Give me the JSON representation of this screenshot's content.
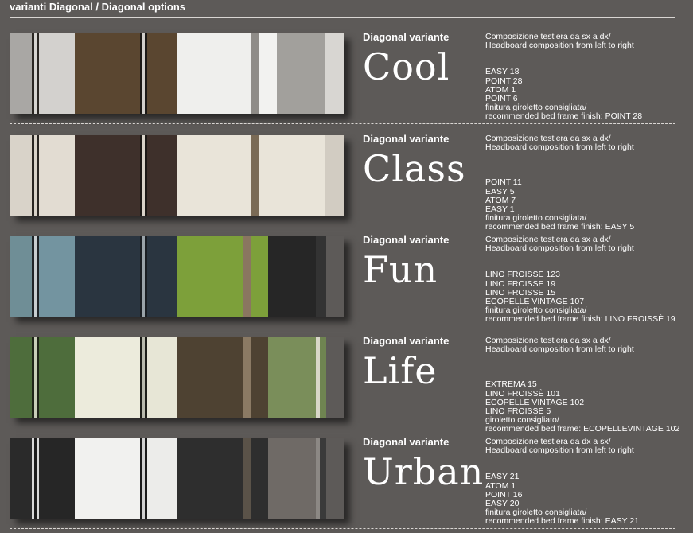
{
  "header": {
    "title": "varianti Diagonal / Diagonal options"
  },
  "rows": [
    {
      "label": "Diagonal variante",
      "name": "Cool",
      "composition_it": "Composizione testiera da sx a dx/",
      "composition_en": "Headboard composition from left to right",
      "items": [
        "EASY 18",
        "POINT 28",
        "ATOM 1",
        "POINT 6"
      ],
      "finish_it": "finitura giroletto consigliata/",
      "finish_en": "recommended bed frame finish: POINT 28",
      "stripes": [
        {
          "color": "#a9a7a4",
          "w": 28
        },
        {
          "color": "#2a2622",
          "w": 3
        },
        {
          "color": "#d6d4d0",
          "w": 3
        },
        {
          "color": "#2a2622",
          "w": 3
        },
        {
          "color": "#d3d1ce",
          "w": 45
        },
        {
          "color": "#5a4630",
          "w": 82
        },
        {
          "color": "#1c1916",
          "w": 3
        },
        {
          "color": "#d2cfcb",
          "w": 3
        },
        {
          "color": "#1c1916",
          "w": 3
        },
        {
          "color": "#5a4630",
          "w": 38
        },
        {
          "color": "#efefed",
          "w": 93
        },
        {
          "color": "#8f8c88",
          "w": 10
        },
        {
          "color": "#f2f2f0",
          "w": 22
        },
        {
          "color": "#a2a09c",
          "w": 60
        },
        {
          "color": "#d8d6d2",
          "w": 24
        }
      ]
    },
    {
      "label": "Diagonal variante",
      "name": "Class",
      "composition_it": "Composizione testiera da sx a dx/",
      "composition_en": "Headboard composition from left to right",
      "items": [
        "POINT 11",
        "EASY 5",
        "ATOM 7",
        "EASY 1"
      ],
      "finish_it": "finitura giroletto consigliata/",
      "finish_en": "recommended bed frame finish: EASY 5",
      "stripes": [
        {
          "color": "#d9d3c9",
          "w": 28
        },
        {
          "color": "#2a2622",
          "w": 3
        },
        {
          "color": "#d9d3c9",
          "w": 3
        },
        {
          "color": "#2a2622",
          "w": 3
        },
        {
          "color": "#e2dcd2",
          "w": 45
        },
        {
          "color": "#3e302b",
          "w": 82
        },
        {
          "color": "#1c1916",
          "w": 3
        },
        {
          "color": "#d9d3c9",
          "w": 3
        },
        {
          "color": "#1c1916",
          "w": 3
        },
        {
          "color": "#3e302b",
          "w": 38
        },
        {
          "color": "#e9e4d9",
          "w": 93
        },
        {
          "color": "#7a6a55",
          "w": 10
        },
        {
          "color": "#e9e4d9",
          "w": 82
        },
        {
          "color": "#d2ccc2",
          "w": 24
        }
      ]
    },
    {
      "label": "Diagonal variante",
      "name": "Fun",
      "composition_it": "Composizione testiera da sx a dx/",
      "composition_en": "Headboard composition from left to right",
      "items": [
        "LINO FROISSE 123",
        "LINO FROISSE 19",
        "LINO FROISSE 15",
        "ECOPELLE VINTAGE 107"
      ],
      "finish_it": "finitura giroletto consigliata/",
      "finish_en": "recommended bed frame finish: LINO FROISSÈ 19",
      "stripes": [
        {
          "color": "#6f8e96",
          "w": 28
        },
        {
          "color": "#1f2428",
          "w": 3
        },
        {
          "color": "#c7cdd0",
          "w": 3
        },
        {
          "color": "#1f2428",
          "w": 3
        },
        {
          "color": "#7394a0",
          "w": 45
        },
        {
          "color": "#2a3540",
          "w": 82
        },
        {
          "color": "#1a1e22",
          "w": 3
        },
        {
          "color": "#9aa3a8",
          "w": 3
        },
        {
          "color": "#1a1e22",
          "w": 3
        },
        {
          "color": "#2a3540",
          "w": 38
        },
        {
          "color": "#7da03a",
          "w": 82
        },
        {
          "color": "#8a7660",
          "w": 10
        },
        {
          "color": "#7da03a",
          "w": 22
        },
        {
          "color": "#262626",
          "w": 60
        },
        {
          "color": "#333333",
          "w": 13
        }
      ]
    },
    {
      "label": "Diagonal variante",
      "name": "Life",
      "composition_it": "Composizione testiera da sx a dx/",
      "composition_en": "Headboard composition from left to right",
      "items": [
        "EXTREMA 15",
        "LINO FROISSÈ 101",
        "ECOPELLE VINTAGE 102",
        "LINO FROISSÈ 5"
      ],
      "finish_it": "giroletto consigliato/",
      "finish_en": "recommended bed frame: ECOPELLEVINTAGE 102",
      "stripes": [
        {
          "color": "#4e6d3c",
          "w": 28
        },
        {
          "color": "#1f2418",
          "w": 3
        },
        {
          "color": "#c8cdb8",
          "w": 3
        },
        {
          "color": "#1f2418",
          "w": 3
        },
        {
          "color": "#4e6d3c",
          "w": 45
        },
        {
          "color": "#ecebdc",
          "w": 82
        },
        {
          "color": "#1c1d18",
          "w": 3
        },
        {
          "color": "#b8b9ac",
          "w": 3
        },
        {
          "color": "#1c1d18",
          "w": 3
        },
        {
          "color": "#e7e6d6",
          "w": 38
        },
        {
          "color": "#4e4232",
          "w": 82
        },
        {
          "color": "#8b7a64",
          "w": 10
        },
        {
          "color": "#4e4232",
          "w": 22
        },
        {
          "color": "#7a8e5a",
          "w": 60
        },
        {
          "color": "#d8d6c8",
          "w": 5
        },
        {
          "color": "#6f8451",
          "w": 8
        }
      ]
    },
    {
      "label": "Diagonal variante",
      "name": "Urban",
      "composition_it": "Composizione testiera da dx a sx/",
      "composition_en": "Headboard composition from left to right",
      "items": [
        "EASY 21",
        "ATOM 1",
        "POINT 16",
        "EASY 20"
      ],
      "finish_it": "finitura giroletto consigliata/",
      "finish_en": "recommended bed frame finish: EASY 21",
      "stripes": [
        {
          "color": "#2a2a2a",
          "w": 28
        },
        {
          "color": "#d8d8d8",
          "w": 3
        },
        {
          "color": "#1a1a1a",
          "w": 3
        },
        {
          "color": "#d8d8d8",
          "w": 3
        },
        {
          "color": "#262626",
          "w": 45
        },
        {
          "color": "#f1f1ef",
          "w": 82
        },
        {
          "color": "#1a1a1a",
          "w": 3
        },
        {
          "color": "#d0d0d0",
          "w": 3
        },
        {
          "color": "#1a1a1a",
          "w": 3
        },
        {
          "color": "#ececea",
          "w": 38
        },
        {
          "color": "#2e2e2e",
          "w": 82
        },
        {
          "color": "#5a5248",
          "w": 10
        },
        {
          "color": "#2e2e2e",
          "w": 22
        },
        {
          "color": "#6f6a66",
          "w": 60
        },
        {
          "color": "#8c8884",
          "w": 5
        },
        {
          "color": "#3a3a3a",
          "w": 8
        }
      ]
    }
  ]
}
